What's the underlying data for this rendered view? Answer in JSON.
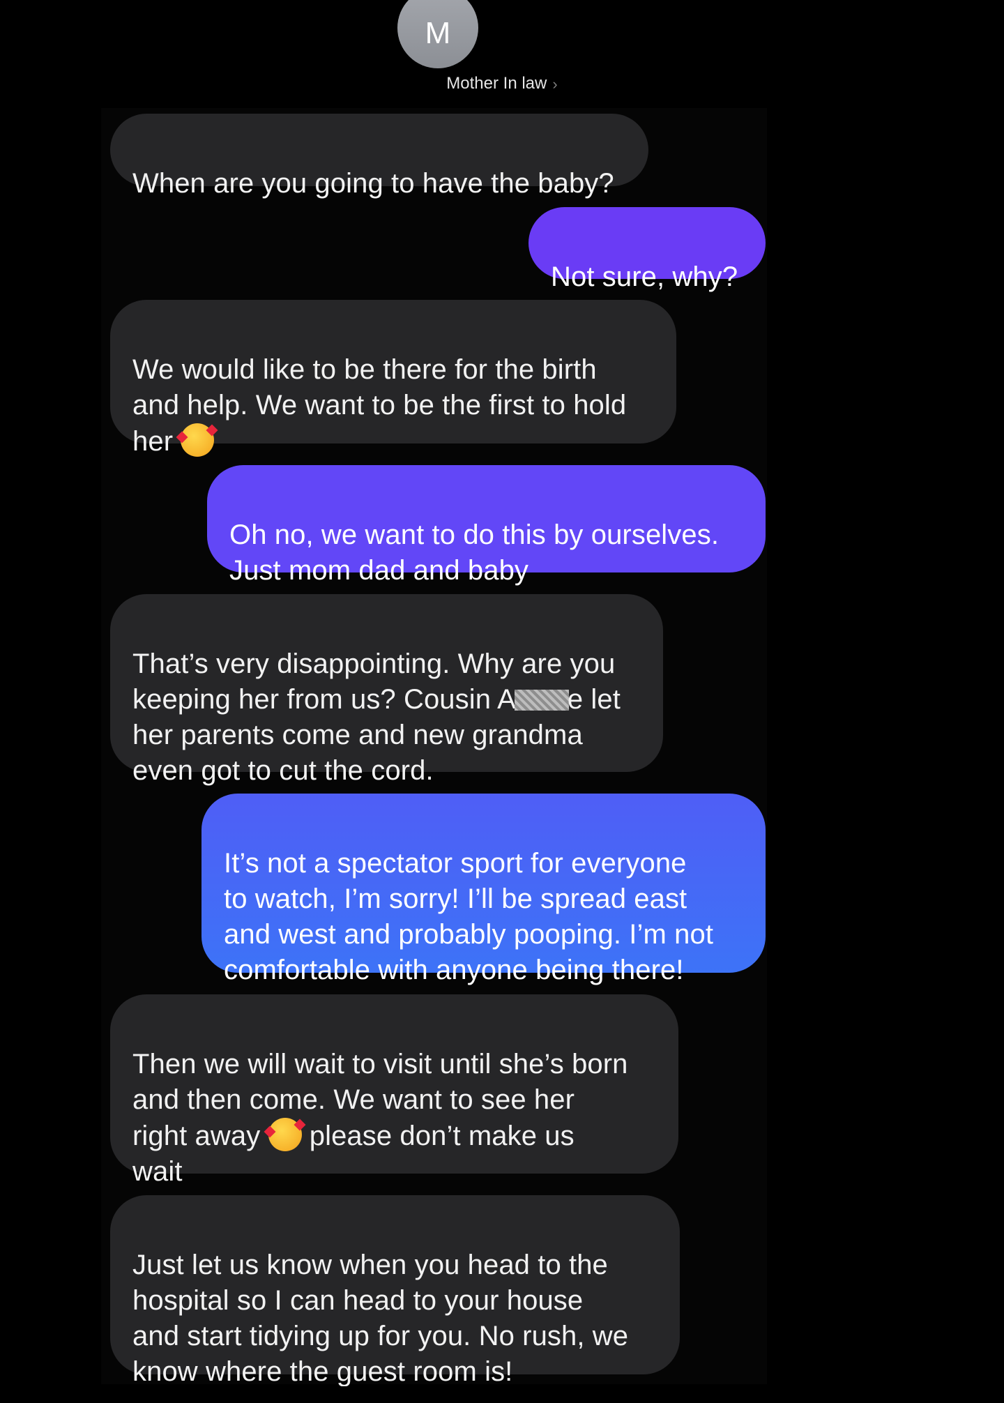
{
  "header": {
    "avatar_initial": "M",
    "contact_name": "Mother In law",
    "chevron": "›"
  },
  "messages": [
    {
      "direction": "incoming",
      "text": "When are you going to have the baby?"
    },
    {
      "direction": "outgoing",
      "text": "Not sure, why?"
    },
    {
      "direction": "incoming",
      "text_parts": [
        "We would like to be there for the birth\nand help. We want to be the first to hold\nher "
      ],
      "emoji": "smiling-face-with-hearts"
    },
    {
      "direction": "outgoing",
      "text": "Oh no, we want to do this by ourselves.\nJust mom dad and baby"
    },
    {
      "direction": "incoming",
      "text_parts": [
        "That’s very disappointing. Why are you\nkeeping her from us? Cousin A",
        "e let\nher parents come and new grandma\neven got to cut the cord."
      ],
      "redacted": true
    },
    {
      "direction": "outgoing",
      "text": "It’s not a spectator sport for everyone\nto watch, I’m sorry! I’ll be spread east\nand west and probably pooping. I’m not\ncomfortable with anyone being there!"
    },
    {
      "direction": "incoming",
      "text_parts": [
        "Then we will wait to visit until she’s born\nand then come. We want to see her\nright away ",
        " please don’t make us\nwait"
      ],
      "emoji": "smiling-face-with-hearts"
    },
    {
      "direction": "incoming",
      "text": "Just let us know when you head to the\nhospital so I can head to your house\nand start tidying up for you. No rush, we\nknow where the guest room is!"
    }
  ],
  "colors": {
    "background": "#000000",
    "incoming_bubble": "#262628",
    "outgoing_bubble_purple": "#6a3cf5",
    "outgoing_bubble_blue": "#3d73f7"
  }
}
